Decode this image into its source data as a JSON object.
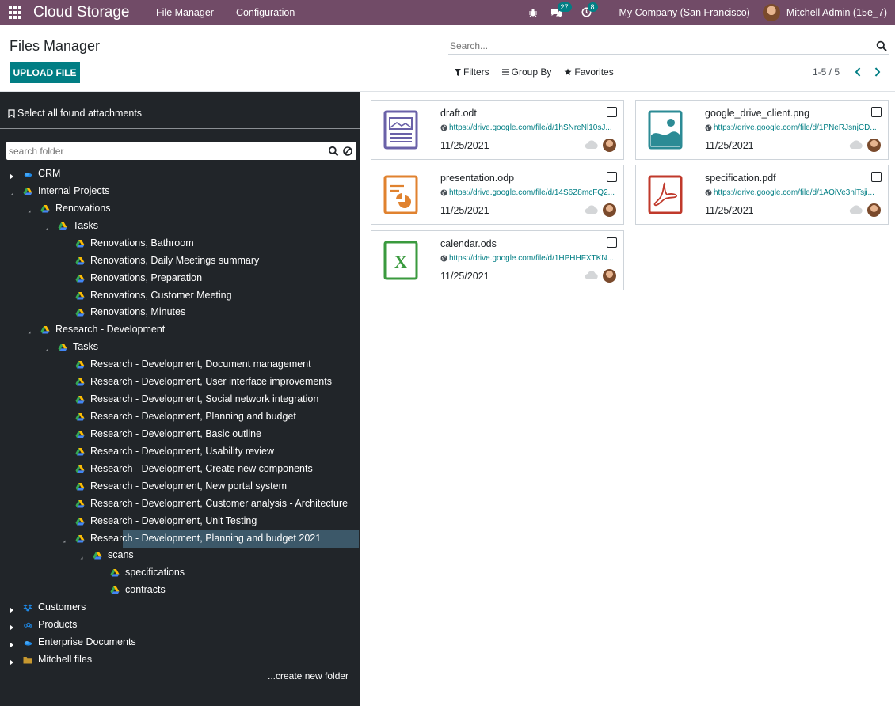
{
  "navbar": {
    "app_name": "Cloud Storage",
    "menus": [
      "File Manager",
      "Configuration"
    ],
    "messages_count": "27",
    "activities_count": "8",
    "company": "My Company (San Francisco)",
    "user": "Mitchell Admin (15e_7)"
  },
  "control_panel": {
    "title": "Files Manager",
    "upload_label": "UPLOAD FILE",
    "search_placeholder": "Search...",
    "filters_label": "Filters",
    "groupby_label": "Group By",
    "favorites_label": "Favorites",
    "pager": "1-5 / 5"
  },
  "sidebar": {
    "select_all_label": "Select all found attachments",
    "search_placeholder": "search folder",
    "create_folder_label": "...create new folder",
    "tree": [
      {
        "label": "CRM",
        "icon": "onedrive-icon",
        "state": "collapsed"
      },
      {
        "label": "Internal Projects",
        "icon": "google-drive-icon",
        "state": "expanded"
      },
      {
        "label": "Renovations",
        "icon": "google-drive-icon",
        "state": "expanded"
      },
      {
        "label": "Tasks",
        "icon": "google-drive-icon",
        "state": "expanded"
      },
      {
        "label": "Renovations, Bathroom",
        "icon": "google-drive-icon",
        "state": "leaf"
      },
      {
        "label": "Renovations, Daily Meetings summary",
        "icon": "google-drive-icon",
        "state": "leaf"
      },
      {
        "label": "Renovations, Preparation",
        "icon": "google-drive-icon",
        "state": "leaf"
      },
      {
        "label": "Renovations, Customer Meeting",
        "icon": "google-drive-icon",
        "state": "leaf"
      },
      {
        "label": "Renovations, Minutes",
        "icon": "google-drive-icon",
        "state": "leaf"
      },
      {
        "label": "Research - Development",
        "icon": "google-drive-icon",
        "state": "expanded"
      },
      {
        "label": "Tasks",
        "icon": "google-drive-icon",
        "state": "expanded"
      },
      {
        "label": "Research - Development, Document management",
        "icon": "google-drive-icon",
        "state": "leaf"
      },
      {
        "label": "Research - Development, User interface improvements",
        "icon": "google-drive-icon",
        "state": "leaf"
      },
      {
        "label": "Research - Development, Social network integration",
        "icon": "google-drive-icon",
        "state": "leaf"
      },
      {
        "label": "Research - Development, Planning and budget",
        "icon": "google-drive-icon",
        "state": "leaf"
      },
      {
        "label": "Research - Development, Basic outline",
        "icon": "google-drive-icon",
        "state": "leaf"
      },
      {
        "label": "Research - Development, Usability review",
        "icon": "google-drive-icon",
        "state": "leaf"
      },
      {
        "label": "Research - Development, Create new components",
        "icon": "google-drive-icon",
        "state": "leaf"
      },
      {
        "label": "Research - Development, New portal system",
        "icon": "google-drive-icon",
        "state": "leaf"
      },
      {
        "label": "Research - Development, Customer analysis - Architecture",
        "icon": "google-drive-icon",
        "state": "leaf"
      },
      {
        "label": "Research - Development, Unit Testing",
        "icon": "google-drive-icon",
        "state": "leaf"
      },
      {
        "label": "Research - Development, Planning and budget 2021",
        "icon": "google-drive-icon",
        "state": "expanded",
        "selected": true
      },
      {
        "label": "scans",
        "icon": "google-drive-icon",
        "state": "expanded"
      },
      {
        "label": "specifications",
        "icon": "google-drive-icon",
        "state": "leaf"
      },
      {
        "label": "contracts",
        "icon": "google-drive-icon",
        "state": "leaf"
      },
      {
        "label": "Customers",
        "icon": "dropbox-icon",
        "state": "collapsed"
      },
      {
        "label": "Products",
        "icon": "owncloud-icon",
        "state": "collapsed"
      },
      {
        "label": "Enterprise Documents",
        "icon": "onedrive-icon",
        "state": "collapsed"
      },
      {
        "label": "Mitchell files",
        "icon": "folder-icon",
        "state": "collapsed"
      }
    ]
  },
  "files": [
    {
      "name": "draft.odt",
      "url": "https://drive.google.com/file/d/1hSNreNl10sJ...",
      "date": "11/25/2021",
      "type": "document",
      "color": "#6a61a8"
    },
    {
      "name": "google_drive_client.png",
      "url": "https://drive.google.com/file/d/1PNeRJsnjCD...",
      "date": "11/25/2021",
      "type": "image",
      "color": "#2c8b95"
    },
    {
      "name": "presentation.odp",
      "url": "https://drive.google.com/file/d/14S6Z8mcFQ2...",
      "date": "11/25/2021",
      "type": "presentation",
      "color": "#e0822f"
    },
    {
      "name": "specification.pdf",
      "url": "https://drive.google.com/file/d/1AOiVe3nlTsji...",
      "date": "11/25/2021",
      "type": "pdf",
      "color": "#c0392b"
    },
    {
      "name": "calendar.ods",
      "url": "https://drive.google.com/file/d/1HPHHFXTKN...",
      "date": "11/25/2021",
      "type": "spreadsheet",
      "color": "#3a9a3e"
    }
  ],
  "colors": {
    "navbar": "#714b67",
    "primary": "#017e84",
    "sidebar": "#212529",
    "selected": "#3c5869"
  }
}
